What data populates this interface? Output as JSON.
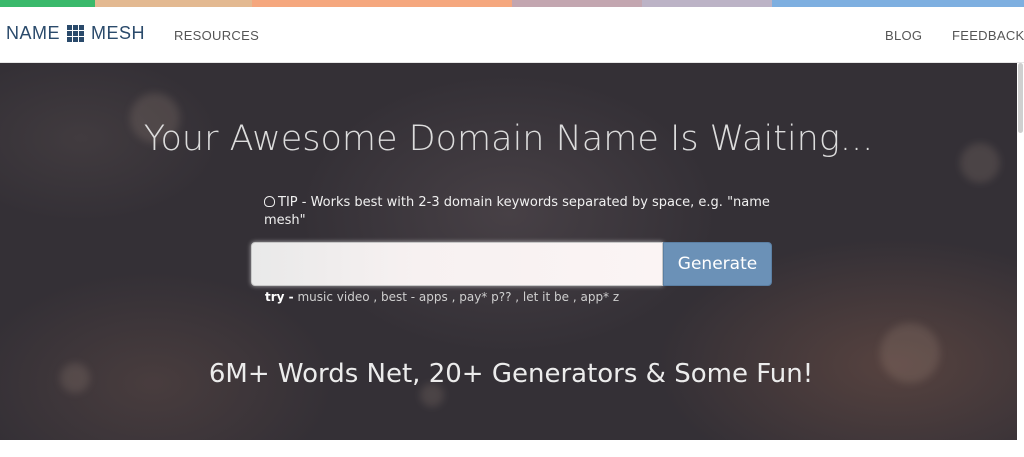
{
  "colors": {
    "stripe": [
      "#3ab96b",
      "#e3b991",
      "#f5a77e",
      "#c3a6b0",
      "#bcb3c6",
      "#7eafe0"
    ],
    "brand": "#2a4a6b",
    "generate_button": "#6b91b7"
  },
  "brand": {
    "name_left": "NAME",
    "name_right": "MESH",
    "icon": "grid-icon"
  },
  "nav": {
    "resources": "RESOURCES",
    "blog": "BLOG",
    "feedback": "FEEDBACK"
  },
  "hero": {
    "title": "Your Awesome Domain Name Is Waiting...",
    "tip_icon": "lightbulb-icon",
    "tip_text": "TIP - Works best with 2-3 domain keywords separated by space, e.g. \"name mesh\"",
    "search": {
      "value": "",
      "placeholder": ""
    },
    "generate_label": "Generate",
    "try_label": "try -",
    "try_examples": [
      {
        "text": "music video",
        "sep": " , "
      },
      {
        "text": "best - apps",
        "sep": " , "
      },
      {
        "text": "pay* p??",
        "sep": " , "
      },
      {
        "text": "let it be",
        "sep": " , "
      },
      {
        "text": "app* z",
        "sep": ""
      }
    ],
    "subtitle": "6M+ Words Net, 20+ Generators & Some Fun!"
  }
}
